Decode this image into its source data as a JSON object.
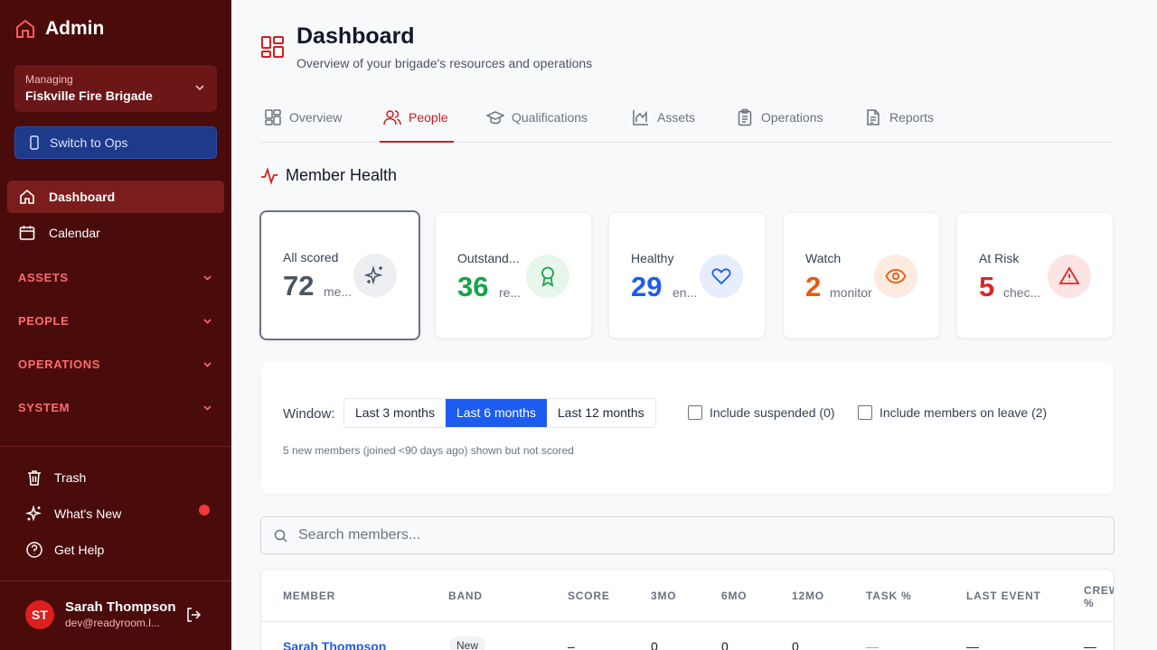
{
  "sidebar": {
    "brand": "Admin",
    "managing_label": "Managing",
    "managing_value": "Fiskville Fire Brigade",
    "switch_label": "Switch to Ops",
    "nav": [
      {
        "label": "Dashboard",
        "icon": "home-icon",
        "active": true
      },
      {
        "label": "Calendar",
        "icon": "calendar-icon",
        "active": false
      }
    ],
    "sections": [
      "ASSETS",
      "PEOPLE",
      "OPERATIONS",
      "SYSTEM"
    ],
    "bottom": [
      {
        "label": "Trash",
        "icon": "trash-icon"
      },
      {
        "label": "What's New",
        "icon": "sparkles-icon"
      },
      {
        "label": "Get Help",
        "icon": "help-circle-icon"
      }
    ],
    "user": {
      "initials": "ST",
      "name": "Sarah Thompson",
      "email": "dev@readyroom.l..."
    }
  },
  "header": {
    "title": "Dashboard",
    "subtitle": "Overview of your brigade's resources and operations"
  },
  "tabs": [
    {
      "label": "Overview",
      "icon": "grid-icon"
    },
    {
      "label": "People",
      "icon": "users-icon",
      "active": true
    },
    {
      "label": "Qualifications",
      "icon": "graduation-cap-icon"
    },
    {
      "label": "Assets",
      "icon": "chart-icon"
    },
    {
      "label": "Operations",
      "icon": "clipboard-icon"
    },
    {
      "label": "Reports",
      "icon": "file-icon"
    }
  ],
  "member_health": {
    "title": "Member Health",
    "cards": [
      {
        "label": "All scored",
        "value": "72",
        "unit": "me...",
        "color": "#4b5563",
        "icon": "sparkles-icon"
      },
      {
        "label": "Outstand...",
        "value": "36",
        "unit": "re...",
        "color": "#16a34a",
        "icon": "award-icon"
      },
      {
        "label": "Healthy",
        "value": "29",
        "unit": "en...",
        "color": "#1d5cf0",
        "icon": "heart-icon"
      },
      {
        "label": "Watch",
        "value": "2",
        "unit": "monitor",
        "color": "#ea580c",
        "icon": "eye-icon"
      },
      {
        "label": "At Risk",
        "value": "5",
        "unit": "chec...",
        "color": "#dc2626",
        "icon": "alert-triangle-icon"
      }
    ]
  },
  "filters": {
    "window_label": "Window:",
    "options": [
      "Last 3 months",
      "Last 6 months",
      "Last 12 months"
    ],
    "selected": "Last 6 months",
    "include_suspended": "Include suspended (0)",
    "include_leave": "Include members on leave (2)",
    "note": "5 new members (joined <90 days ago) shown but not scored"
  },
  "search": {
    "placeholder": "Search members..."
  },
  "table": {
    "headers": [
      "MEMBER",
      "BAND",
      "SCORE",
      "3MO",
      "6MO",
      "12MO",
      "TASK %",
      "LAST EVENT",
      "CREW",
      "%"
    ],
    "row": {
      "member": "Sarah Thompson",
      "band": "New",
      "score": "–",
      "m3": "0",
      "m6": "0",
      "m12": "0",
      "task": "—",
      "last_event": "—",
      "crew": "—"
    }
  },
  "colors": {
    "sidebar_bg": "#4a0b0b",
    "accent_red": "#c81e1e",
    "accent_blue": "#1d5cf0"
  }
}
